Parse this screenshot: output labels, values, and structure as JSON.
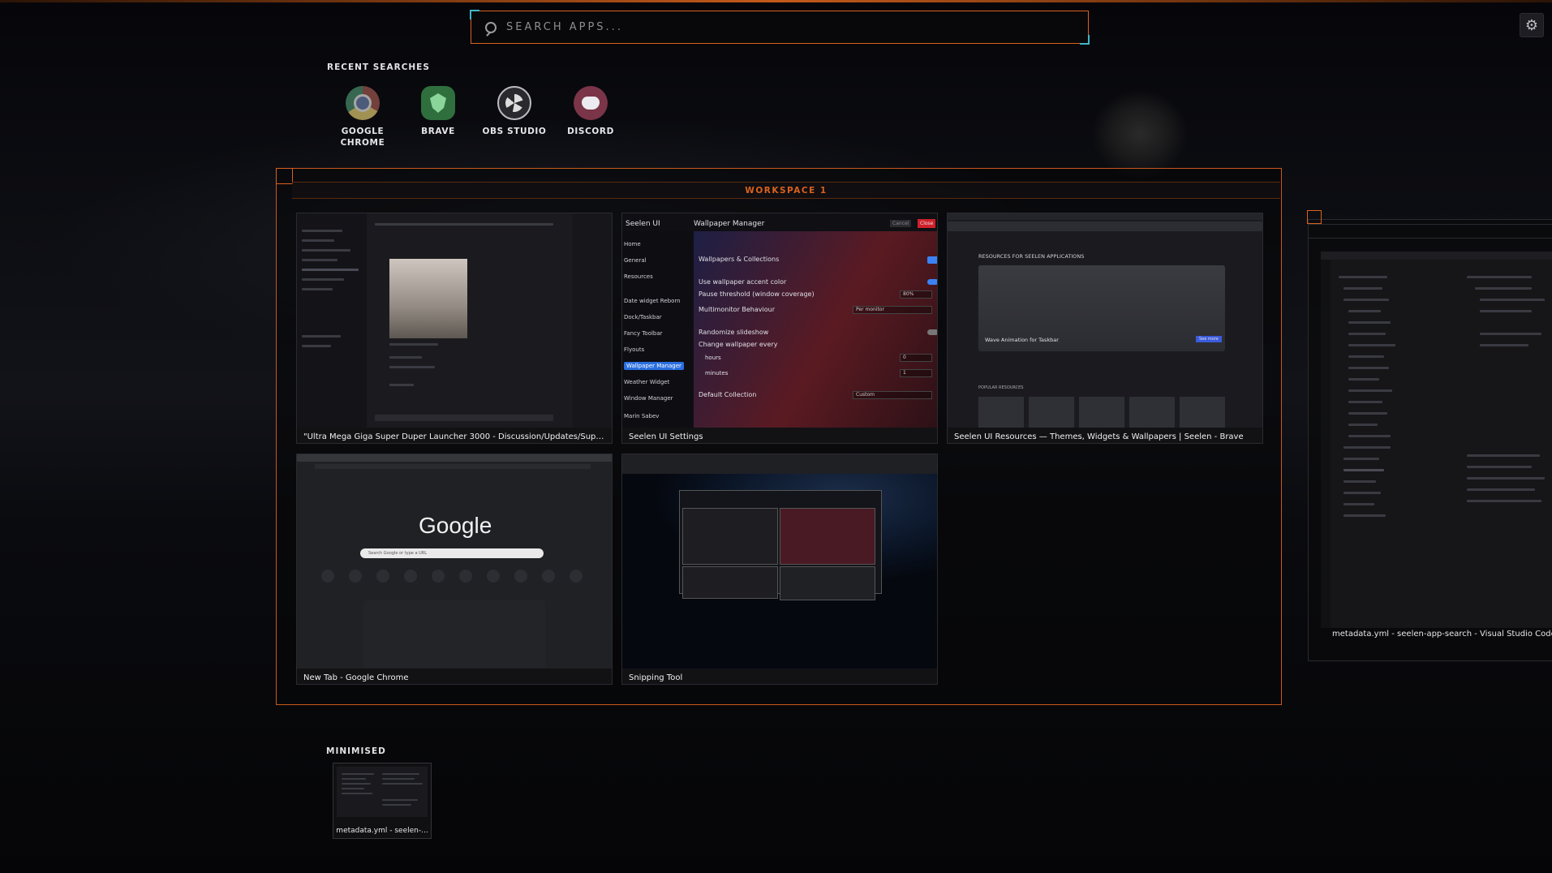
{
  "search": {
    "placeholder": "SEARCH APPS..."
  },
  "recent": {
    "title": "RECENT SEARCHES",
    "apps": [
      {
        "label": "GOOGLE\nCHROME",
        "icon": "chrome-icon"
      },
      {
        "label": "BRAVE",
        "icon": "brave-icon"
      },
      {
        "label": "OBS STUDIO",
        "icon": "obs-icon"
      },
      {
        "label": "DISCORD",
        "icon": "discord-icon"
      }
    ]
  },
  "workspace": {
    "title": "WORKSPACE 1",
    "windows": [
      {
        "title": "\"Ultra Mega Giga Super Duper Launcher 3000 - Discussion/Updates/Support\" | Seelen Network - Discord"
      },
      {
        "title": "Seelen UI Settings"
      },
      {
        "title": "Seelen UI Resources — Themes, Widgets & Wallpapers | Seelen - Brave"
      },
      {
        "title": "New Tab - Google Chrome"
      },
      {
        "title": "Snipping Tool"
      }
    ]
  },
  "settings_thumb": {
    "app": "Seelen UI",
    "section": "Wallpaper Manager",
    "nav": [
      "Home",
      "General",
      "Resources",
      "Date widget Reborn",
      "Dock/Taskbar",
      "Fancy Toolbar",
      "Flyouts",
      "Wallpaper Manager",
      "Weather Widget",
      "Window Manager"
    ],
    "rows": [
      "Wallpapers & Collections",
      "Use wallpaper accent color",
      "Pause threshold (window coverage)",
      "Multimonitor Behaviour",
      "Randomize slideshow",
      "Change wallpaper every",
      "hours",
      "minutes",
      "Default Collection"
    ],
    "values": {
      "pause": "80%",
      "multimonitor": "Per monitor",
      "hours": "0",
      "minutes": "1",
      "collection": "Custom"
    },
    "user": "Marin Sabev",
    "cancel": "Cancel",
    "close": "Close"
  },
  "brave_thumb": {
    "heading": "RESOURCES FOR SEELEN APPLICATIONS",
    "feature": "Wave Animation for Taskbar",
    "button": "See more",
    "popular": "POPULAR RESOURCES"
  },
  "chrome_thumb": {
    "logo": "Google",
    "search": "Search Google or type a URL"
  },
  "side_window": {
    "title": "metadata.yml - seelen-app-search - Visual Studio Code [Administrator]"
  },
  "minimised": {
    "title": "MINIMISED",
    "items": [
      {
        "label": "metadata.yml - seelen-..."
      }
    ]
  },
  "colors": {
    "accent": "#d9611e",
    "focus_corner": "#3fb5c8",
    "background": "#07070a"
  }
}
